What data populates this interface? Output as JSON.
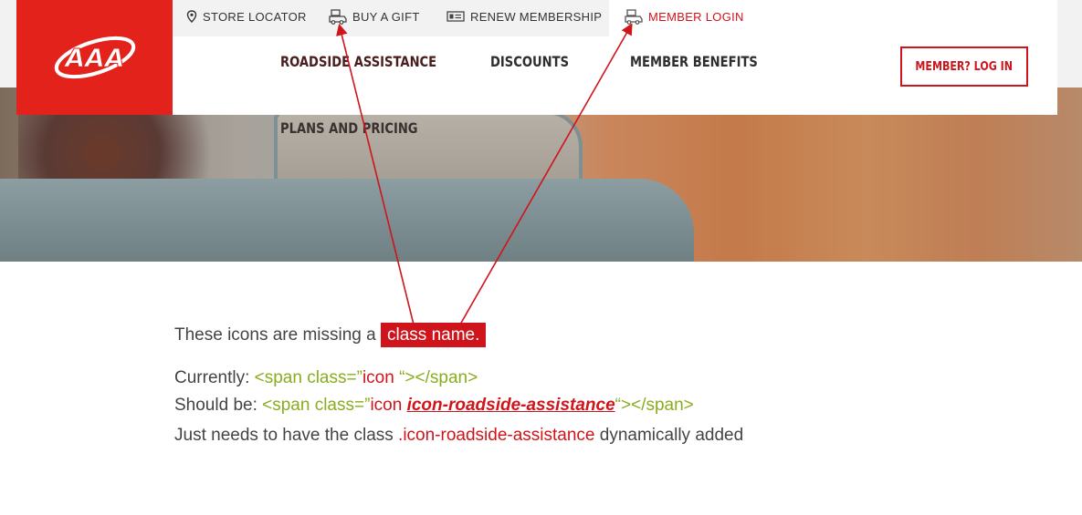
{
  "brand": {
    "logo_text": "AAA",
    "color": "#e3221b"
  },
  "utility_nav": {
    "store_locator": "STORE LOCATOR",
    "buy_gift": "BUY A GIFT",
    "renew": "RENEW MEMBERSHIP",
    "member_login": "MEMBER LOGIN"
  },
  "main_nav": {
    "roadside": "ROADSIDE ASSISTANCE",
    "discounts": "DISCOUNTS",
    "benefits": "MEMBER BENEFITS",
    "plans": "PLANS AND PRICING"
  },
  "login_button": "MEMBER? LOG IN",
  "annotation": {
    "line1_pre": "These icons are missing a ",
    "line1_highlight": "class name.",
    "currently_label": "Currently: ",
    "currently_code_a": "<span class=”",
    "currently_code_b": "icon ",
    "currently_code_c": "“></span>",
    "should_label": "Should be: ",
    "should_code_a": "<span class=”",
    "should_code_b": "icon ",
    "should_code_c": "icon-roadside-assistance",
    "should_code_d": "“></span>",
    "line4_pre": "Just needs to have the class ",
    "line4_class": ".icon-roadside-assistance",
    "line4_post": " dynamically added"
  },
  "colors": {
    "accent": "#d0141b",
    "code_green": "#8aac1e"
  }
}
